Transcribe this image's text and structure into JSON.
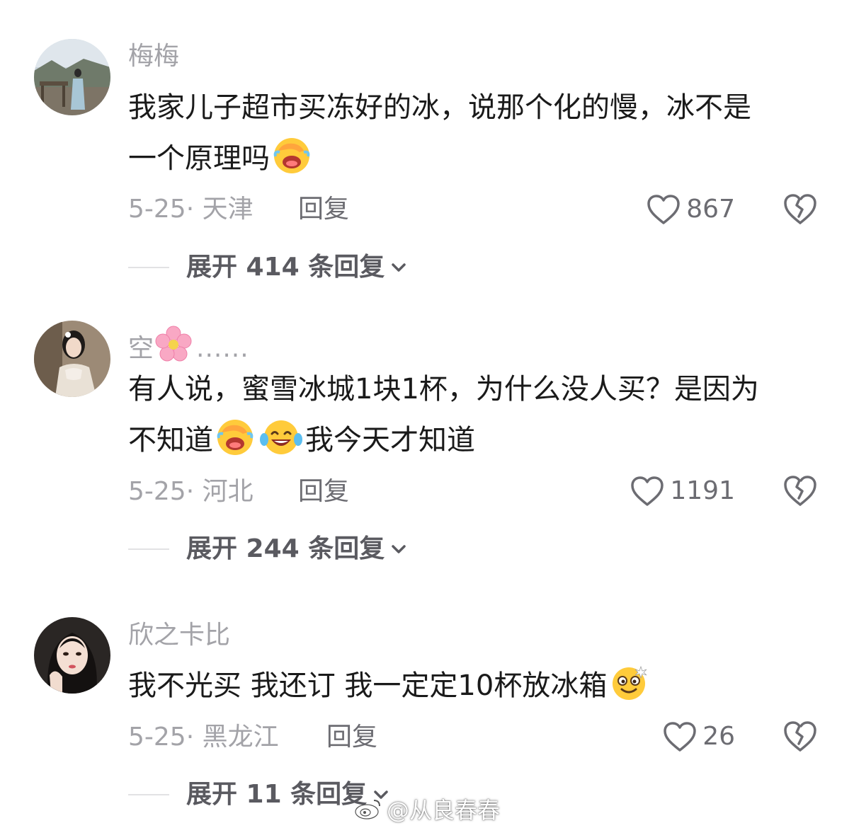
{
  "comments": [
    {
      "username": "梅梅",
      "text_line1": "我家儿子超市买冻好的冰，说那个化的慢，冰不是",
      "text_line2": "一个原理吗",
      "emojis": [
        "facepalm-laugh-emoji"
      ],
      "date_location": "5-25· 天津",
      "reply_label": "回复",
      "likes": "867",
      "expand_label": "展开 414 条回复"
    },
    {
      "username": "空",
      "username_suffix": "......",
      "username_emoji": "cherry-blossom-emoji",
      "text_line1": "有人说，蜜雪冰城1块1杯，为什么没人买？是因为",
      "text_line2a": "不知道",
      "text_line2b": "我今天才知道",
      "emojis": [
        "facepalm-laugh-emoji",
        "tears-of-joy-emoji"
      ],
      "date_location": "5-25· 河北",
      "reply_label": "回复",
      "likes": "1191",
      "expand_label": "展开 244 条回复"
    },
    {
      "username": "欣之卡比",
      "text_line1": "我不光买 我还订 我一定定10杯放冰箱",
      "emojis": [
        "dizzy-smile-emoji"
      ],
      "date_location": "5-25· 黑龙江",
      "reply_label": "回复",
      "likes": "26",
      "expand_label": "展开 11 条回复"
    }
  ],
  "watermark": "@从良春春",
  "colors": {
    "meta_gray": "#a3a3a8",
    "action_gray": "#6c6c72",
    "text": "#1a1a1a",
    "background": "#ffffff"
  }
}
